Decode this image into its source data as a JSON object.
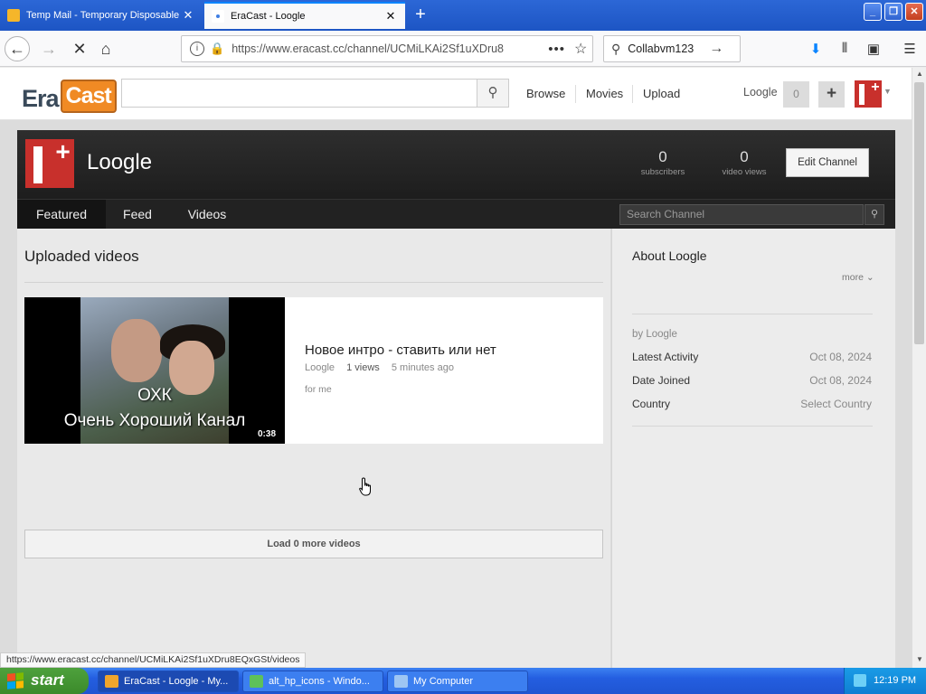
{
  "browser": {
    "tabs": [
      {
        "title": "Temp Mail - Temporary Disposable"
      },
      {
        "title": "EraCast - Loogle"
      }
    ],
    "url": "https://www.eracast.cc/channel/UCMiLKAi2Sf1uXDru8",
    "search_text": "Collabvm123",
    "status_url": "https://www.eracast.cc/channel/UCMiLKAi2Sf1uXDru8EQxGSt/videos"
  },
  "site": {
    "logo_left": "Era",
    "logo_right": "Cast",
    "nav": [
      "Browse",
      "Movies",
      "Upload"
    ],
    "username": "Loogle",
    "notification_count": "0"
  },
  "channel": {
    "name": "Loogle",
    "subscribers": {
      "count": "0",
      "label": "subscribers"
    },
    "video_views": {
      "count": "0",
      "label": "video views"
    },
    "edit_label": "Edit Channel",
    "tabs": [
      "Featured",
      "Feed",
      "Videos"
    ],
    "search_placeholder": "Search Channel"
  },
  "main": {
    "section_title": "Uploaded videos",
    "video": {
      "caption_line1": "ОХК",
      "caption_line2": "Очень Хороший Канал",
      "duration": "0:38",
      "title": "Новое интро - ставить или нет",
      "author": "Loogle",
      "views": "1 views",
      "time": "5 minutes ago",
      "description": "for me"
    },
    "load_more": "Load 0 more videos"
  },
  "about": {
    "title": "About Loogle",
    "more": "more",
    "by": "by Loogle",
    "rows": [
      {
        "label": "Latest Activity",
        "value": "Oct 08, 2024"
      },
      {
        "label": "Date Joined",
        "value": "Oct 08, 2024"
      },
      {
        "label": "Country",
        "value": "Select Country"
      }
    ]
  },
  "taskbar": {
    "start": "start",
    "tasks": [
      "EraCast - Loogle - My...",
      "alt_hp_icons - Windo...",
      "My Computer"
    ],
    "clock": "12:19 PM"
  },
  "colors": {
    "accent": "#0a84ff",
    "brand_orange": "#f08a24",
    "channel_header": "#222222"
  }
}
